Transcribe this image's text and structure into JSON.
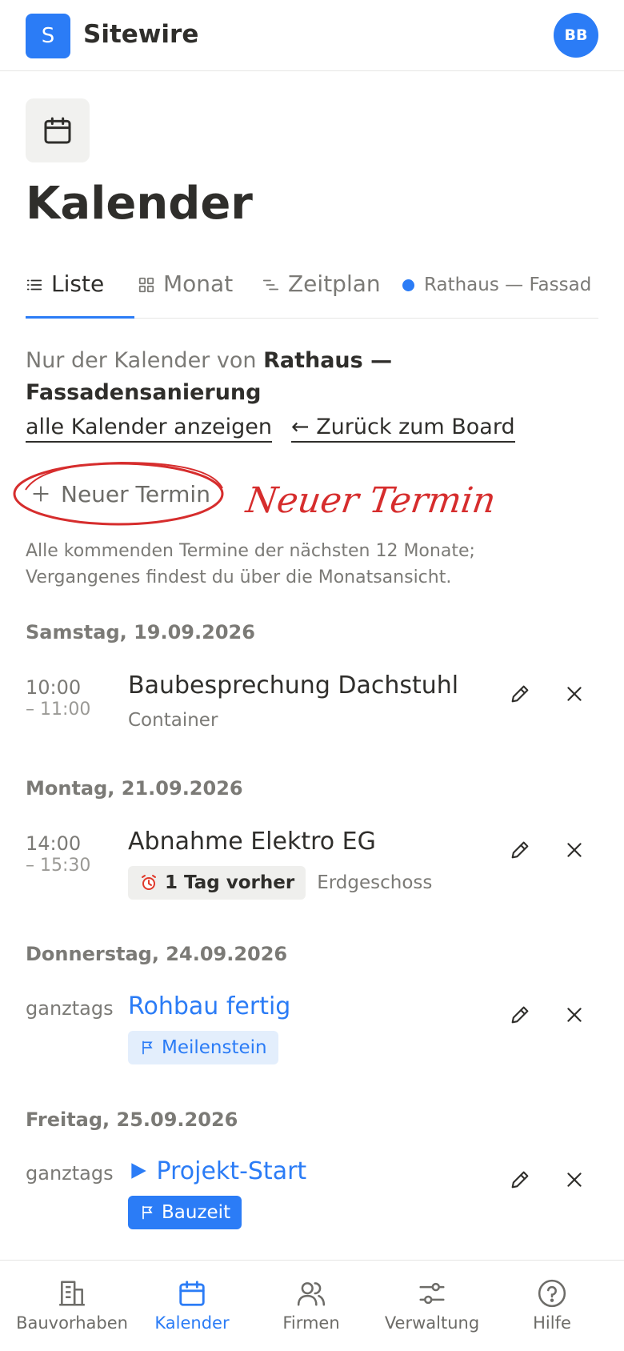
{
  "app": {
    "logo_letter": "S",
    "brand": "Sitewire",
    "avatar_initials": "BB"
  },
  "page": {
    "title": "Kalender"
  },
  "tabs": [
    {
      "label": "Liste",
      "active": true
    },
    {
      "label": "Monat",
      "active": false
    },
    {
      "label": "Zeitplan",
      "active": false
    }
  ],
  "project_filter_label": "Rathaus — Fassad",
  "filter": {
    "prefix": "Nur der Kalender von",
    "project": "Rathaus — Fassadensanierung",
    "show_all_label": "alle Kalender anzeigen",
    "back_label": "← Zurück zum Board"
  },
  "new_event_button": "Neuer Termin",
  "annotation": {
    "text": "Neuer Termin",
    "color": "#d62d2d"
  },
  "hint": "Alle kommenden Termine der nächsten 12 Monate; Vergangenes findest du über die Monatsansicht.",
  "days": [
    {
      "heading": "Samstag, 19.09.2026",
      "event": {
        "time_start": "10:00",
        "time_end": "– 11:00",
        "title": "Baubesprechung Dachstuhl",
        "location": "Container"
      }
    },
    {
      "heading": "Montag, 21.09.2026",
      "event": {
        "time_start": "14:00",
        "time_end": "– 15:30",
        "title": "Abnahme Elektro EG",
        "badge": "1 Tag vorher",
        "badge_icon": "alarm-clock-icon",
        "location": "Erdgeschoss"
      }
    },
    {
      "heading": "Donnerstag, 24.09.2026",
      "event": {
        "time_start": "ganztags",
        "title": "Rohbau fertig",
        "badge": "Meilenstein",
        "badge_icon": "flag-icon"
      }
    },
    {
      "heading": "Freitag, 25.09.2026",
      "event": {
        "time_start": "ganztags",
        "title": "Projekt-Start",
        "title_icon": "play-icon",
        "badge": "Bauzeit",
        "badge_icon": "flag-icon"
      }
    }
  ],
  "bottom_nav": [
    {
      "label": "Bauvorhaben",
      "icon": "building-icon",
      "active": false
    },
    {
      "label": "Kalender",
      "icon": "calendar-icon",
      "active": true
    },
    {
      "label": "Firmen",
      "icon": "users-icon",
      "active": false
    },
    {
      "label": "Verwaltung",
      "icon": "sliders-icon",
      "active": false
    },
    {
      "label": "Hilfe",
      "icon": "help-circle-icon",
      "active": false
    }
  ],
  "colors": {
    "accent": "#2b7cf6",
    "text": "#2f2e2b",
    "muted": "#7b7a76",
    "annotation": "#d62d2d"
  }
}
